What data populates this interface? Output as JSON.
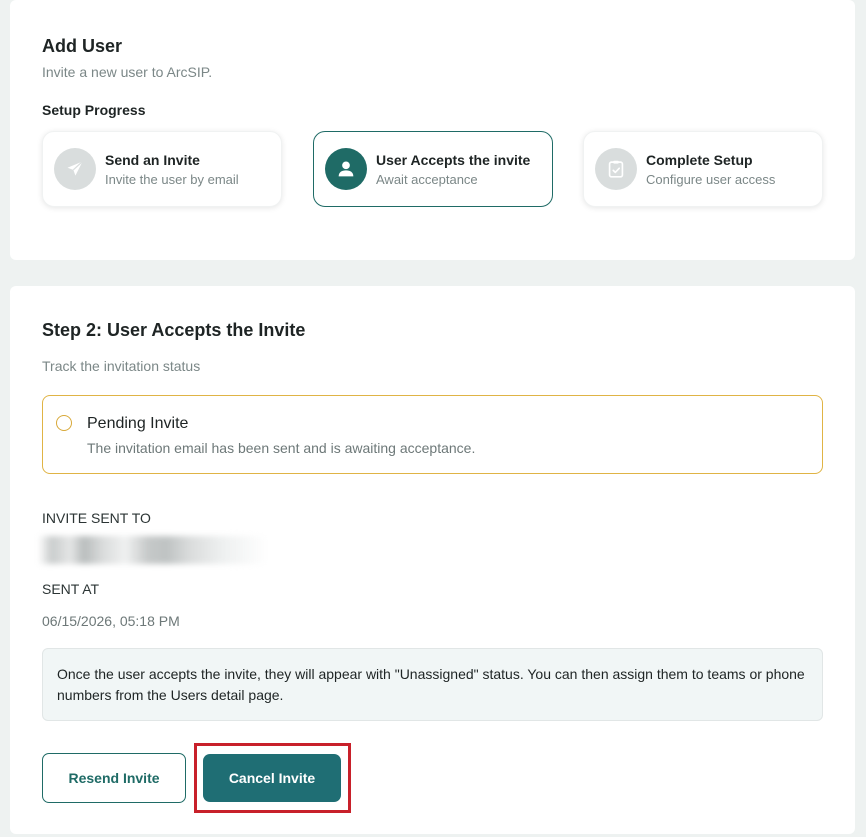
{
  "header": {
    "title": "Add User",
    "subtitle": "Invite a new user to ArcSIP.",
    "setup_label": "Setup Progress"
  },
  "steps": [
    {
      "title": "Send an Invite",
      "description": "Invite the user by email",
      "icon": "send-icon",
      "state": "done"
    },
    {
      "title": "User Accepts the invite",
      "description": "Await acceptance",
      "icon": "user-icon",
      "state": "active"
    },
    {
      "title": "Complete Setup",
      "description": "Configure user access",
      "icon": "clipboard-check-icon",
      "state": "pending"
    }
  ],
  "step_detail": {
    "heading": "Step 2: User Accepts the Invite",
    "subheading": "Track the invitation status",
    "status": {
      "title": "Pending Invite",
      "description": "The invitation email has been sent and is awaiting acceptance."
    },
    "invite_sent_to_label": "INVITE SENT TO",
    "sent_at_label": "SENT AT",
    "sent_at_value": "06/15/2026, 05:18 PM",
    "info_text": "Once the user accepts the invite, they will appear with \"Unassigned\" status. You can then assign them to teams or phone numbers from the Users detail page."
  },
  "actions": {
    "resend_label": "Resend Invite",
    "cancel_label": "Cancel Invite"
  },
  "colors": {
    "accent": "#1f6b66",
    "pending": "#e0b445",
    "highlight": "#c8202a"
  }
}
